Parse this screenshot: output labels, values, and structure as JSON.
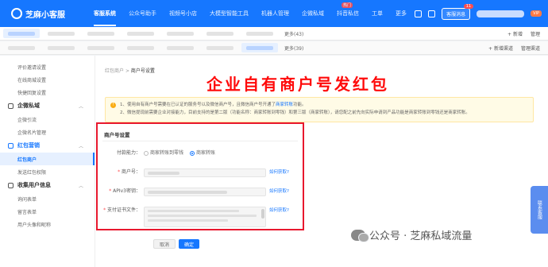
{
  "app": {
    "name": "芝麻小客服"
  },
  "nav": {
    "items": [
      "客服系统",
      "公众号助手",
      "视频号小店",
      "大模型智能工具",
      "机器人管理",
      "企微私域",
      "抖音私信",
      "工单",
      "更多"
    ],
    "hot_badge": "热门",
    "message_button": "客服消息",
    "message_count": "11",
    "vip_badge": "VIP"
  },
  "tabs_primary": {
    "more": "更多(43)",
    "actions": [
      "+ 新增",
      "管理"
    ]
  },
  "tabs_secondary": {
    "more": "更多(39)",
    "actions": [
      "+ 新增渠道",
      "管理渠道"
    ]
  },
  "sidebar": {
    "items_top": [
      "评价邀请设置",
      "在线商城设置",
      "快捷回复设置"
    ],
    "groups": [
      {
        "label": "企微私域",
        "items": [
          "企微引流",
          "企微名片管理"
        ]
      },
      {
        "label": "红包营销",
        "items": [
          "红包商户",
          "发送红包权限"
        ]
      },
      {
        "label": "收集用户信息",
        "items": [
          "询问表单",
          "留言表单",
          "用户头像和昵称"
        ]
      }
    ],
    "active_item": "红包商户"
  },
  "breadcrumb": {
    "parent": "红包商户",
    "separator": ">",
    "current": "商户号设置"
  },
  "headline": "企业自有商户号发红包",
  "notice": {
    "line1_prefix": "1、使用自有商户号需要在已认证的服务号以及微信商户号，且微信商户号开通了",
    "line1_link": "商家转账",
    "line1_suffix": "功能。",
    "line2": "2、微信提现前需要企业对接能力，目前支持的是第二版（功能名称：商家转账到零钱）和第三版（商家转账），请您配之前先向实际申请到产品功能是商家转账到零钱还是商家转账。"
  },
  "form": {
    "title": "商户号设置",
    "payment_label": "付款能力：",
    "payment_options": [
      "商家转账到零钱",
      "商家转账"
    ],
    "payment_selected": 1,
    "merchant_label": "商户号：",
    "apiv3_label": "APIv3密钥：",
    "cert_label": "支付证书文件：",
    "how_to_get": "如何获取?",
    "cancel": "取消",
    "confirm": "确定"
  },
  "watermark": {
    "text": "公众号 · 芝麻私域流量"
  },
  "float_tab": {
    "text": "联系客服"
  }
}
